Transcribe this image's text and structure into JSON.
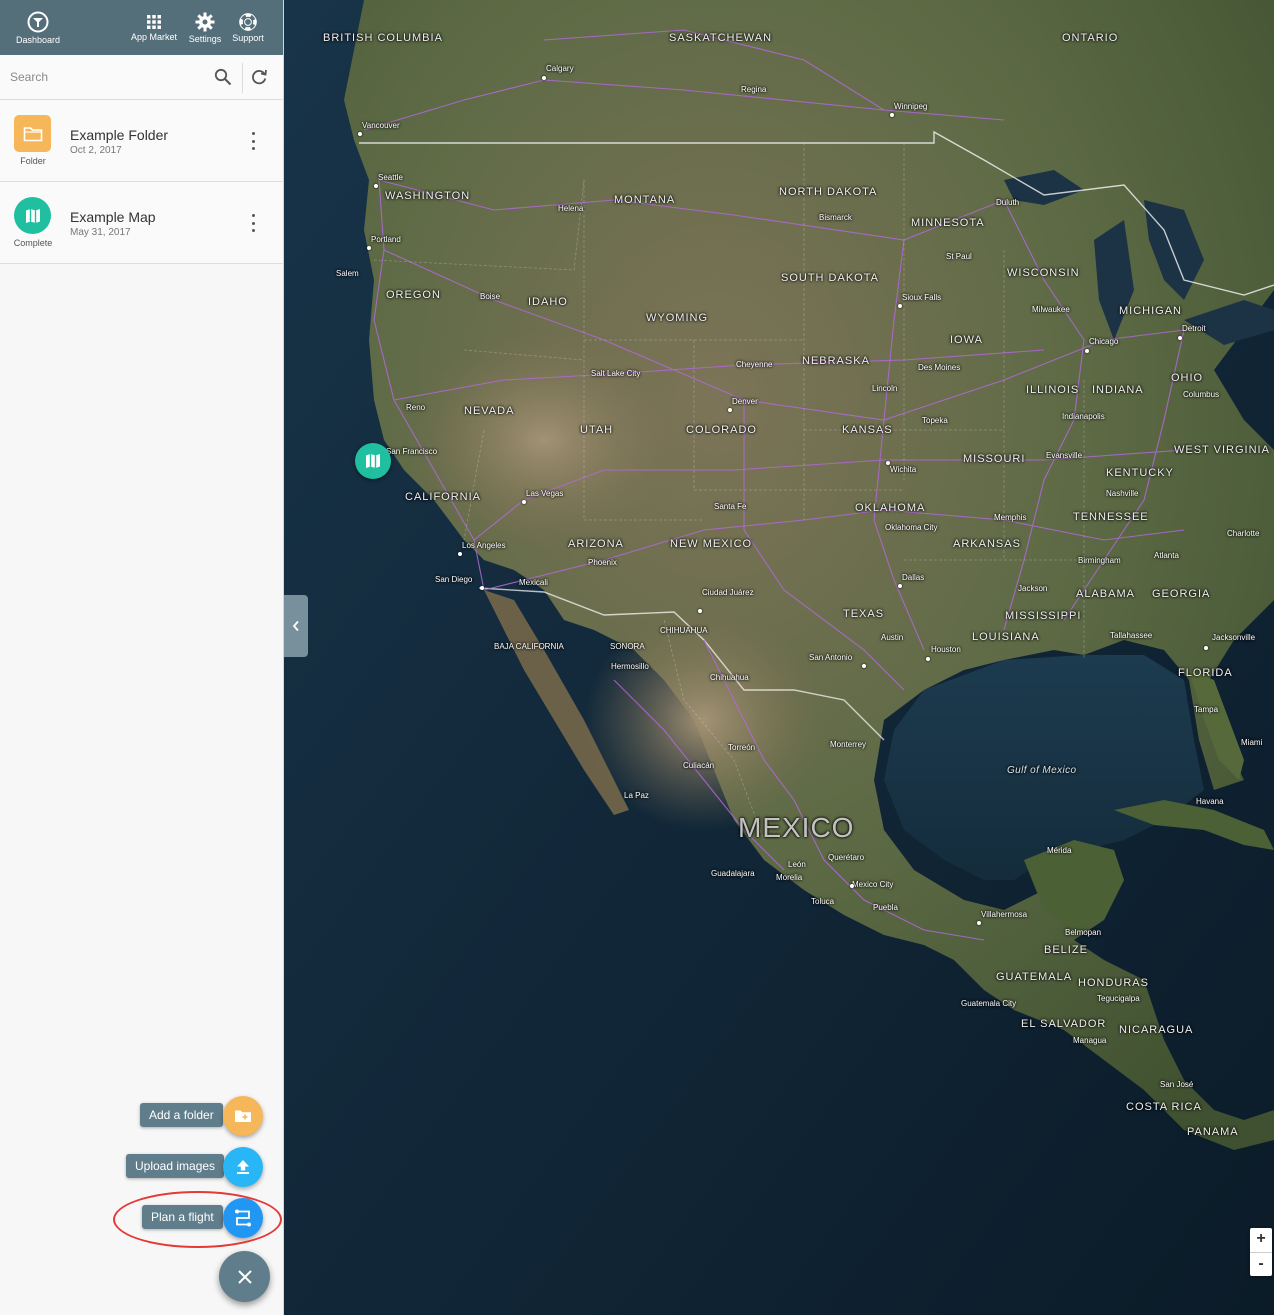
{
  "topbar": {
    "dashboard": "Dashboard",
    "app_market": "App Market",
    "settings": "Settings",
    "support": "Support"
  },
  "search": {
    "placeholder": "Search"
  },
  "items": [
    {
      "name": "Example Folder",
      "date": "Oct 2, 2017",
      "type": "Folder",
      "icon": "folder-icon"
    },
    {
      "name": "Example Map",
      "date": "May 31, 2017",
      "type": "Complete",
      "icon": "map-icon"
    }
  ],
  "actions": {
    "add_folder": "Add a folder",
    "upload_images": "Upload images",
    "plan_flight": "Plan a flight"
  },
  "colors": {
    "topbar": "#546e7a",
    "folder": "#f6b75a",
    "map": "#1fbf9f",
    "upload": "#29b6f6",
    "plan": "#2196f3",
    "highlight": "#e53935"
  },
  "zoom": {
    "in": "+",
    "out": "-"
  },
  "map": {
    "labels": {
      "bc": "BRITISH COLUMBIA",
      "sk": "SASKATCHEWAN",
      "on": "ONTARIO",
      "wa": "WASHINGTON",
      "mt": "MONTANA",
      "nd": "NORTH DAKOTA",
      "mn": "MINNESOTA",
      "or": "OREGON",
      "id": "IDAHO",
      "wy": "WYOMING",
      "sd": "SOUTH DAKOTA",
      "wi": "WISCONSIN",
      "mi": "MICHIGAN",
      "ia": "IOWA",
      "ne": "NEBRASKA",
      "nv": "NEVADA",
      "ut": "UTAH",
      "co": "COLORADO",
      "ks": "KANSAS",
      "mo": "MISSOURI",
      "il": "ILLINOIS",
      "in": "INDIANA",
      "oh": "OHIO",
      "ca": "CALIFORNIA",
      "az": "ARIZONA",
      "nm": "NEW MEXICO",
      "ok": "OKLAHOMA",
      "ar": "ARKANSAS",
      "ky": "KENTUCKY",
      "tn": "TENNESSEE",
      "wv": "WEST VIRGINIA",
      "tx": "TEXAS",
      "la": "LOUISIANA",
      "ms": "MISSISSIPPI",
      "al": "ALABAMA",
      "ga": "GEORGIA",
      "fl": "FLORIDA",
      "mx": "MEXICO",
      "gulf": "Gulf of Mexico",
      "bz": "BELIZE",
      "gt": "GUATEMALA",
      "hn": "HONDURAS",
      "sv": "EL SALVADOR",
      "ni": "NICARAGUA",
      "cr": "COSTA RICA",
      "pa": "PANAMA",
      "sonora": "SONORA",
      "chihuahua": "CHIHUAHUA",
      "bajacal": "BAJA CALIFORNIA"
    },
    "cities": {
      "vancouver": "Vancouver",
      "calgary": "Calgary",
      "regina": "Regina",
      "winnipeg": "Winnipeg",
      "seattle": "Seattle",
      "helena": "Helena",
      "bismarck": "Bismarck",
      "duluth": "Duluth",
      "portland": "Portland",
      "salem": "Salem",
      "boise": "Boise",
      "stpaul": "St Paul",
      "siouxfalls": "Sioux Falls",
      "milwaukee": "Milwaukee",
      "chicago": "Chicago",
      "detroit": "Detroit",
      "slc": "Salt Lake City",
      "cheyenne": "Cheyenne",
      "desmoines": "Des Moines",
      "lincoln": "Lincoln",
      "reno": "Reno",
      "denver": "Denver",
      "sf": "San Francisco",
      "topeka": "Topeka",
      "indianapolis": "Indianapolis",
      "columbus": "Columbus",
      "evansville": "Evansville",
      "wichita": "Wichita",
      "lasvegas": "Las Vegas",
      "nashville": "Nashville",
      "santafe": "Santa Fe",
      "memphis": "Memphis",
      "okc": "Oklahoma City",
      "la": "Los Angeles",
      "phoenix": "Phoenix",
      "charlotte": "Charlotte",
      "sandiego": "San Diego",
      "mexicali": "Mexicali",
      "birmingham": "Birmingham",
      "atlanta": "Atlanta",
      "dallas": "Dallas",
      "juarez": "Ciudad Juárez",
      "jackson": "Jackson",
      "austin": "Austin",
      "houston": "Houston",
      "sanantonio": "San Antonio",
      "tallahassee": "Tallahassee",
      "jacksonville": "Jacksonville",
      "hermosillo": "Hermosillo",
      "chihuahuacity": "Chihuahua",
      "tampa": "Tampa",
      "miami": "Miami",
      "torreon": "Torreón",
      "monterrey": "Monterrey",
      "culiacan": "Culiacán",
      "lapaz": "La Paz",
      "havana": "Havana",
      "leon": "León",
      "queretaro": "Querétaro",
      "guadalajara": "Guadalajara",
      "morelia": "Morelia",
      "mexicocity": "Mexico City",
      "toluca": "Toluca",
      "puebla": "Puebla",
      "merida": "Mérida",
      "villahermosa": "Villahermosa",
      "belmopan": "Belmopan",
      "guatemalacity": "Guatemala City",
      "tegucigalpa": "Tegucigalpa",
      "managua": "Managua",
      "sanjose": "San José"
    }
  }
}
